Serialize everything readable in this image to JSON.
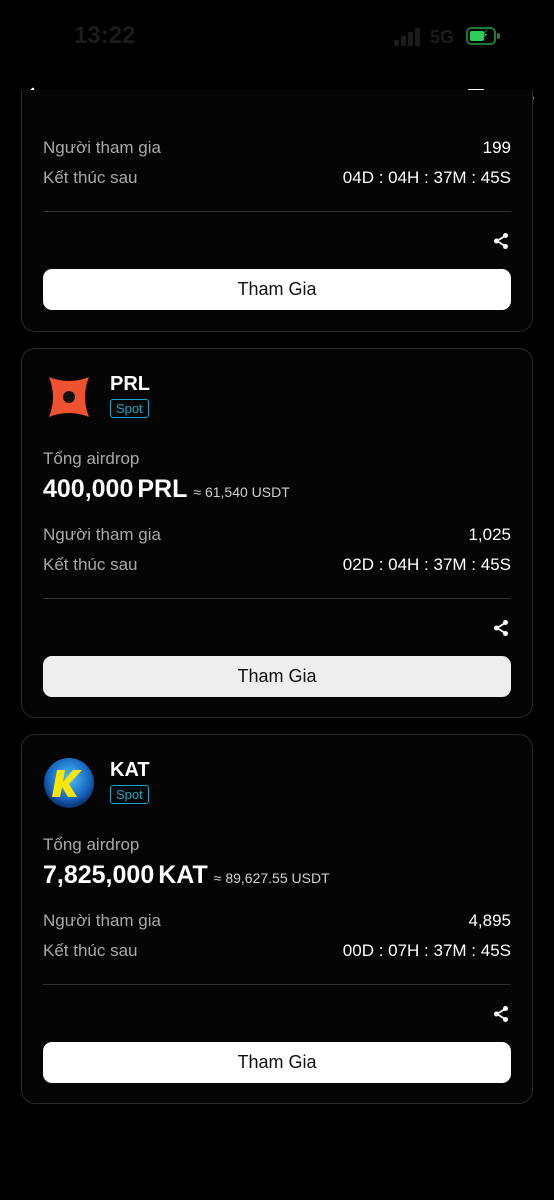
{
  "status_bar": {
    "time": "13:22",
    "network": "5G"
  },
  "nav": {
    "back_icon": "arrow-left-icon",
    "bell_icon": "bell-check-icon",
    "doc_icon": "question-doc-icon",
    "more_icon": "more-horizontal-icon"
  },
  "cards": [
    {
      "participants_label": "Người tham gia",
      "participants_value": "199",
      "ends_label": "Kết thúc sau",
      "ends_value": "04D : 04H : 37M : 45S",
      "join_label": "Tham Gia"
    },
    {
      "token": "PRL",
      "tag": "Spot",
      "total_label": "Tổng airdrop",
      "amount": "400,000",
      "symbol": "PRL",
      "approx": "≈ 61,540 USDT",
      "participants_label": "Người tham gia",
      "participants_value": "1,025",
      "ends_label": "Kết thúc sau",
      "ends_value": "02D : 04H : 37M : 45S",
      "join_label": "Tham Gia"
    },
    {
      "token": "KAT",
      "tag": "Spot",
      "total_label": "Tổng airdrop",
      "amount": "7,825,000",
      "symbol": "KAT",
      "approx": "≈ 89,627.55 USDT",
      "participants_label": "Người tham gia",
      "participants_value": "4,895",
      "ends_label": "Kết thúc sau",
      "ends_value": "00D : 07H : 37M : 45S",
      "join_label": "Tham Gia"
    }
  ],
  "colors": {
    "accent_tag": "#1aa7c9",
    "prl_logo": "#f0512f",
    "kat_logo": "#1565c0"
  }
}
